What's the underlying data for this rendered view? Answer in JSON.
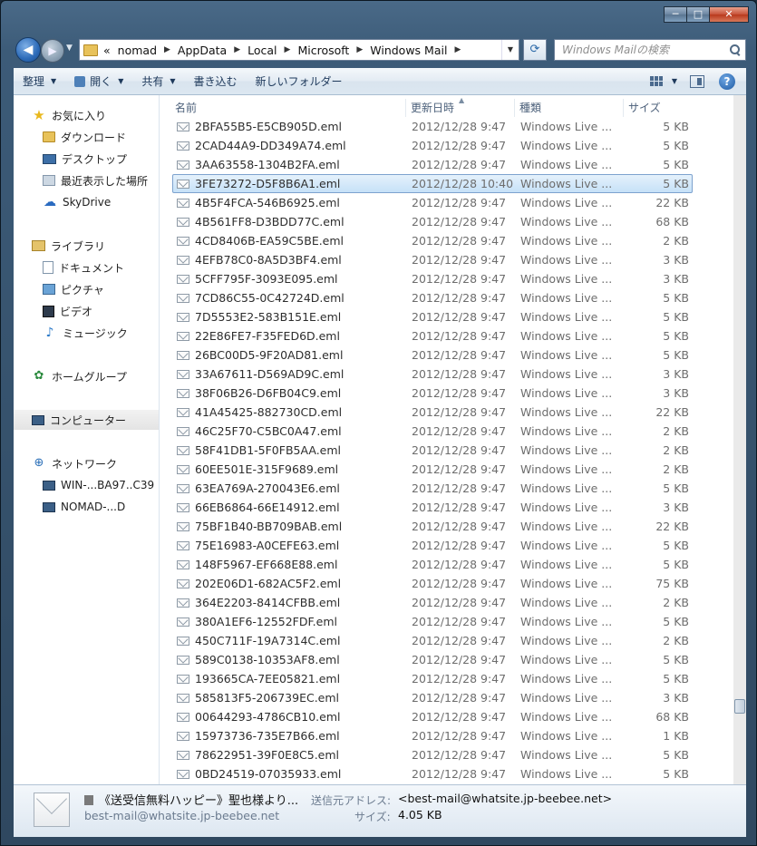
{
  "window": {
    "caption": {
      "minimize": "─",
      "maximize": "□",
      "close": "✕"
    }
  },
  "address": {
    "overflow": "«",
    "crumbs": [
      "nomad",
      "AppData",
      "Local",
      "Microsoft",
      "Windows Mail"
    ],
    "search_placeholder": "Windows Mailの検索"
  },
  "toolbar": {
    "organize": "整理",
    "open": "開く",
    "share": "共有",
    "burn": "書き込む",
    "new_folder": "新しいフォルダー",
    "help": "?"
  },
  "navpane": {
    "favorites": "お気に入り",
    "downloads": "ダウンロード",
    "desktop": "デスクトップ",
    "recent": "最近表示した場所",
    "skydrive": "SkyDrive",
    "libraries": "ライブラリ",
    "documents": "ドキュメント",
    "pictures": "ピクチャ",
    "videos": "ビデオ",
    "music": "ミュージック",
    "homegroup": "ホームグループ",
    "computer": "コンピューター",
    "network": "ネットワーク",
    "net_host1": "WIN-...BA97..C39",
    "net_host2": "NOMAD-...D"
  },
  "columns": {
    "name": "名前",
    "date": "更新日時",
    "type": "種類",
    "size": "サイズ"
  },
  "files": [
    {
      "name": "2BFA55B5-E5CB905D.eml",
      "date": "2012/12/28 9:47",
      "type": "Windows Live ...",
      "size": "5 KB"
    },
    {
      "name": "2CAD44A9-DD349A74.eml",
      "date": "2012/12/28 9:47",
      "type": "Windows Live ...",
      "size": "5 KB"
    },
    {
      "name": "3AA63558-1304B2FA.eml",
      "date": "2012/12/28 9:47",
      "type": "Windows Live ...",
      "size": "5 KB"
    },
    {
      "name": "3FE73272-D5F8B6A1.eml",
      "date": "2012/12/28 10:40",
      "type": "Windows Live ...",
      "size": "5 KB",
      "selected": true
    },
    {
      "name": "4B5F4FCA-546B6925.eml",
      "date": "2012/12/28 9:47",
      "type": "Windows Live ...",
      "size": "22 KB"
    },
    {
      "name": "4B561FF8-D3BDD77C.eml",
      "date": "2012/12/28 9:47",
      "type": "Windows Live ...",
      "size": "68 KB"
    },
    {
      "name": "4CD8406B-EA59C5BE.eml",
      "date": "2012/12/28 9:47",
      "type": "Windows Live ...",
      "size": "2 KB"
    },
    {
      "name": "4EFB78C0-8A5D3BF4.eml",
      "date": "2012/12/28 9:47",
      "type": "Windows Live ...",
      "size": "3 KB"
    },
    {
      "name": "5CFF795F-3093E095.eml",
      "date": "2012/12/28 9:47",
      "type": "Windows Live ...",
      "size": "3 KB"
    },
    {
      "name": "7CD86C55-0C42724D.eml",
      "date": "2012/12/28 9:47",
      "type": "Windows Live ...",
      "size": "5 KB"
    },
    {
      "name": "7D5553E2-583B151E.eml",
      "date": "2012/12/28 9:47",
      "type": "Windows Live ...",
      "size": "5 KB"
    },
    {
      "name": "22E86FE7-F35FED6D.eml",
      "date": "2012/12/28 9:47",
      "type": "Windows Live ...",
      "size": "5 KB"
    },
    {
      "name": "26BC00D5-9F20AD81.eml",
      "date": "2012/12/28 9:47",
      "type": "Windows Live ...",
      "size": "5 KB"
    },
    {
      "name": "33A67611-D569AD9C.eml",
      "date": "2012/12/28 9:47",
      "type": "Windows Live ...",
      "size": "3 KB"
    },
    {
      "name": "38F06B26-D6FB04C9.eml",
      "date": "2012/12/28 9:47",
      "type": "Windows Live ...",
      "size": "3 KB"
    },
    {
      "name": "41A45425-882730CD.eml",
      "date": "2012/12/28 9:47",
      "type": "Windows Live ...",
      "size": "22 KB"
    },
    {
      "name": "46C25F70-C5BC0A47.eml",
      "date": "2012/12/28 9:47",
      "type": "Windows Live ...",
      "size": "2 KB"
    },
    {
      "name": "58F41DB1-5F0FB5AA.eml",
      "date": "2012/12/28 9:47",
      "type": "Windows Live ...",
      "size": "2 KB"
    },
    {
      "name": "60EE501E-315F9689.eml",
      "date": "2012/12/28 9:47",
      "type": "Windows Live ...",
      "size": "2 KB"
    },
    {
      "name": "63EA769A-270043E6.eml",
      "date": "2012/12/28 9:47",
      "type": "Windows Live ...",
      "size": "5 KB"
    },
    {
      "name": "66EB6864-66E14912.eml",
      "date": "2012/12/28 9:47",
      "type": "Windows Live ...",
      "size": "3 KB"
    },
    {
      "name": "75BF1B40-BB709BAB.eml",
      "date": "2012/12/28 9:47",
      "type": "Windows Live ...",
      "size": "22 KB"
    },
    {
      "name": "75E16983-A0CEFE63.eml",
      "date": "2012/12/28 9:47",
      "type": "Windows Live ...",
      "size": "5 KB"
    },
    {
      "name": "148F5967-EF668E88.eml",
      "date": "2012/12/28 9:47",
      "type": "Windows Live ...",
      "size": "5 KB"
    },
    {
      "name": "202E06D1-682AC5F2.eml",
      "date": "2012/12/28 9:47",
      "type": "Windows Live ...",
      "size": "75 KB"
    },
    {
      "name": "364E2203-8414CFBB.eml",
      "date": "2012/12/28 9:47",
      "type": "Windows Live ...",
      "size": "2 KB"
    },
    {
      "name": "380A1EF6-12552FDF.eml",
      "date": "2012/12/28 9:47",
      "type": "Windows Live ...",
      "size": "5 KB"
    },
    {
      "name": "450C711F-19A7314C.eml",
      "date": "2012/12/28 9:47",
      "type": "Windows Live ...",
      "size": "2 KB"
    },
    {
      "name": "589C0138-10353AF8.eml",
      "date": "2012/12/28 9:47",
      "type": "Windows Live ...",
      "size": "5 KB"
    },
    {
      "name": "193665CA-7EE05821.eml",
      "date": "2012/12/28 9:47",
      "type": "Windows Live ...",
      "size": "5 KB"
    },
    {
      "name": "585813F5-206739EC.eml",
      "date": "2012/12/28 9:47",
      "type": "Windows Live ...",
      "size": "3 KB"
    },
    {
      "name": "00644293-4786CB10.eml",
      "date": "2012/12/28 9:47",
      "type": "Windows Live ...",
      "size": "68 KB"
    },
    {
      "name": "15973736-735E7B66.eml",
      "date": "2012/12/28 9:47",
      "type": "Windows Live ...",
      "size": "1 KB"
    },
    {
      "name": "78622951-39F0E8C5.eml",
      "date": "2012/12/28 9:47",
      "type": "Windows Live ...",
      "size": "5 KB"
    },
    {
      "name": "0BD24519-07035933.eml",
      "date": "2012/12/28 9:47",
      "type": "Windows Live ...",
      "size": "5 KB"
    }
  ],
  "details": {
    "subject": "《送受信無料ハッピー》聖也様より...",
    "from_short": "best-mail@whatsite.jp-beebee.net",
    "sender_label": "送信元アドレス:",
    "sender_value": "<best-mail@whatsite.jp-beebee.net>",
    "size_label": "サイズ:",
    "size_value": "4.05 KB"
  }
}
